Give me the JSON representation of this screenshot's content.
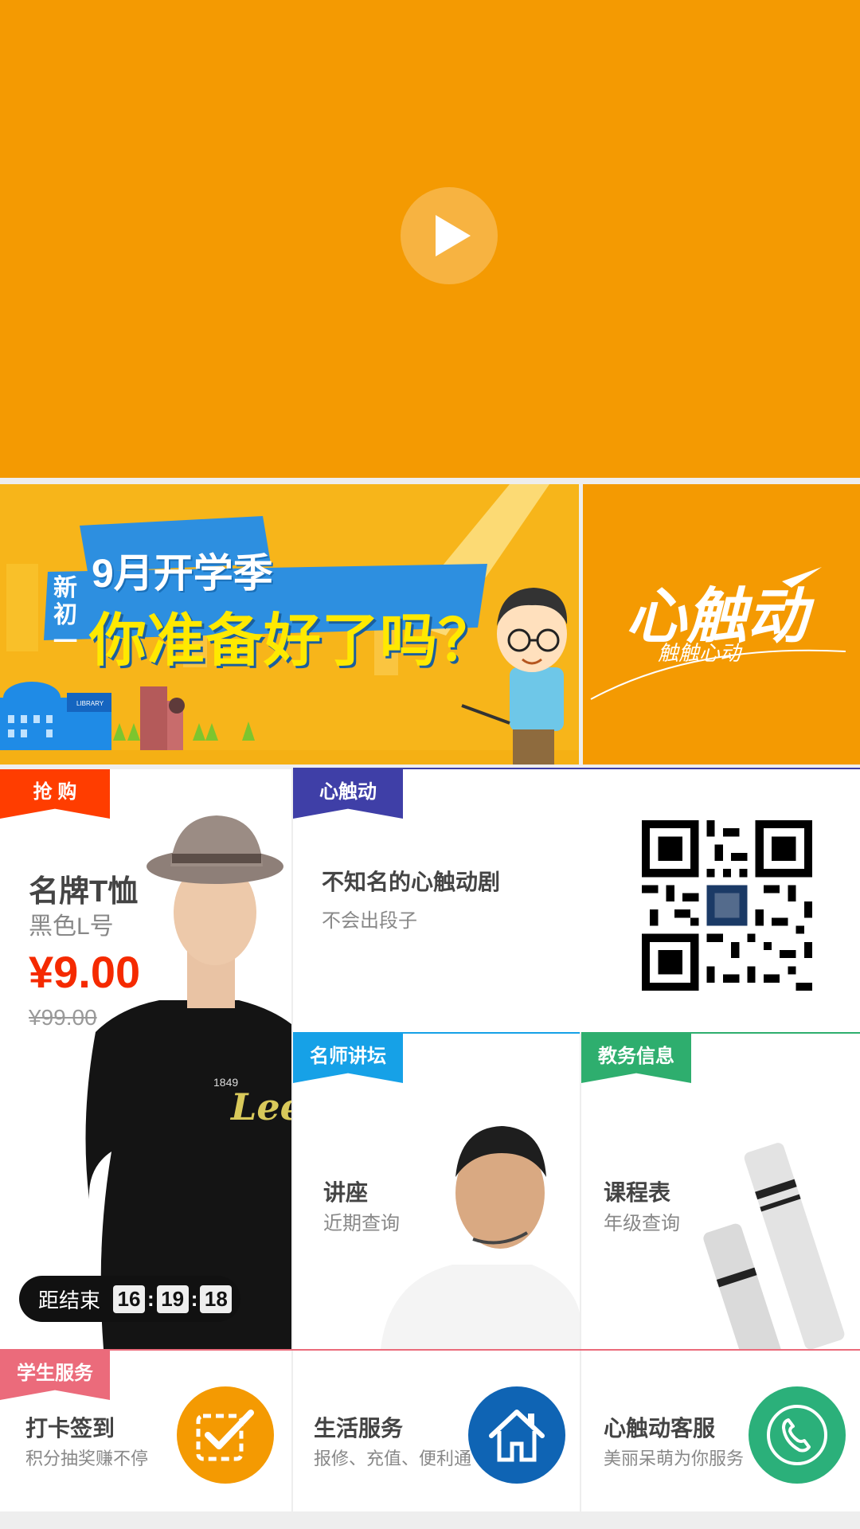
{
  "video": {
    "play_icon": "play-icon",
    "bg": "#F49A02"
  },
  "banner": {
    "tag": "新初一",
    "headline_small": "9月开学季",
    "headline_big": "你准备好了吗？",
    "library_sign": "LIBRARY",
    "side_logo": "心触动",
    "side_slogan": "触触心动"
  },
  "deal": {
    "ribbon": "抢 购",
    "title": "名牌T恤",
    "spec": "黑色L号",
    "price": "¥9.00",
    "original_price": "¥99.00",
    "timer_label": "距结束",
    "timer": {
      "h": "16",
      "m": "19",
      "s": "18"
    },
    "accent": "#FF3D00"
  },
  "brand_card": {
    "ribbon": "心触动",
    "title": "不知名的心触动剧",
    "subtitle": "不会出段子",
    "accent": "#3F3FA7"
  },
  "lecture_card": {
    "ribbon": "名师讲坛",
    "title": "讲座",
    "subtitle": "近期查询",
    "accent": "#16A1E7"
  },
  "academic_card": {
    "ribbon": "教务信息",
    "title": "课程表",
    "subtitle": "年级查询",
    "accent": "#2EAE6E"
  },
  "services": {
    "ribbon": "学生服务",
    "items": [
      {
        "title": "打卡签到",
        "subtitle": "积分抽奖赚不停",
        "icon": "checkbox-icon",
        "color": "#F49A02"
      },
      {
        "title": "生活服务",
        "subtitle": "报修、充值、便利通",
        "icon": "home-icon",
        "color": "#0F64B4"
      },
      {
        "title": "心触动客服",
        "subtitle": "美丽呆萌为你服务",
        "icon": "phone-icon",
        "color": "#2BB07A"
      }
    ]
  }
}
